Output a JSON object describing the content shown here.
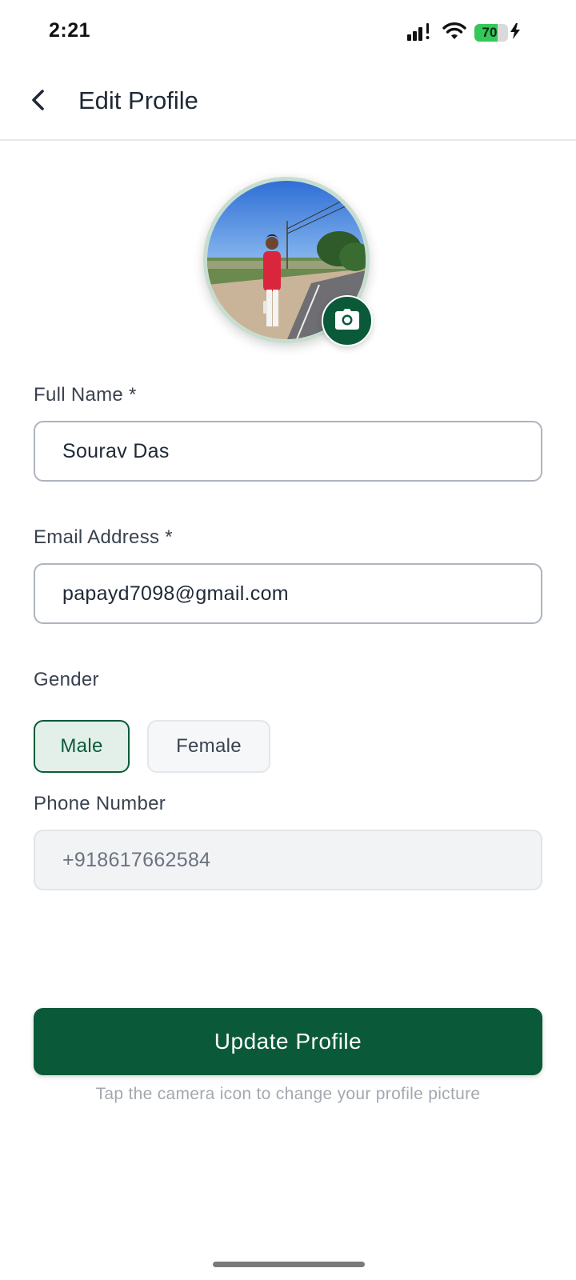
{
  "status_bar": {
    "time": "2:21",
    "battery_percent": "70",
    "battery_level": 0.7,
    "icons": [
      "signal-icon",
      "wifi-icon",
      "battery-icon",
      "charging-bolt-icon"
    ]
  },
  "header": {
    "title": "Edit Profile",
    "back_icon": "chevron-left-icon"
  },
  "avatar": {
    "camera_icon": "camera-icon"
  },
  "form": {
    "full_name": {
      "label": "Full Name *",
      "value": "Sourav Das"
    },
    "email": {
      "label": "Email Address *",
      "value": "papayd7098@gmail.com"
    },
    "gender": {
      "label": "Gender",
      "options": [
        "Male",
        "Female"
      ],
      "selected": "Male"
    },
    "phone": {
      "label": "Phone Number",
      "value": "+918617662584"
    }
  },
  "actions": {
    "update_label": "Update Profile",
    "hint": "Tap the camera icon to change your profile picture"
  },
  "colors": {
    "primary": "#0a5a39",
    "selected_bg": "#e3efe9",
    "hint_text": "#a3a8b0",
    "battery_green": "#34c759"
  }
}
